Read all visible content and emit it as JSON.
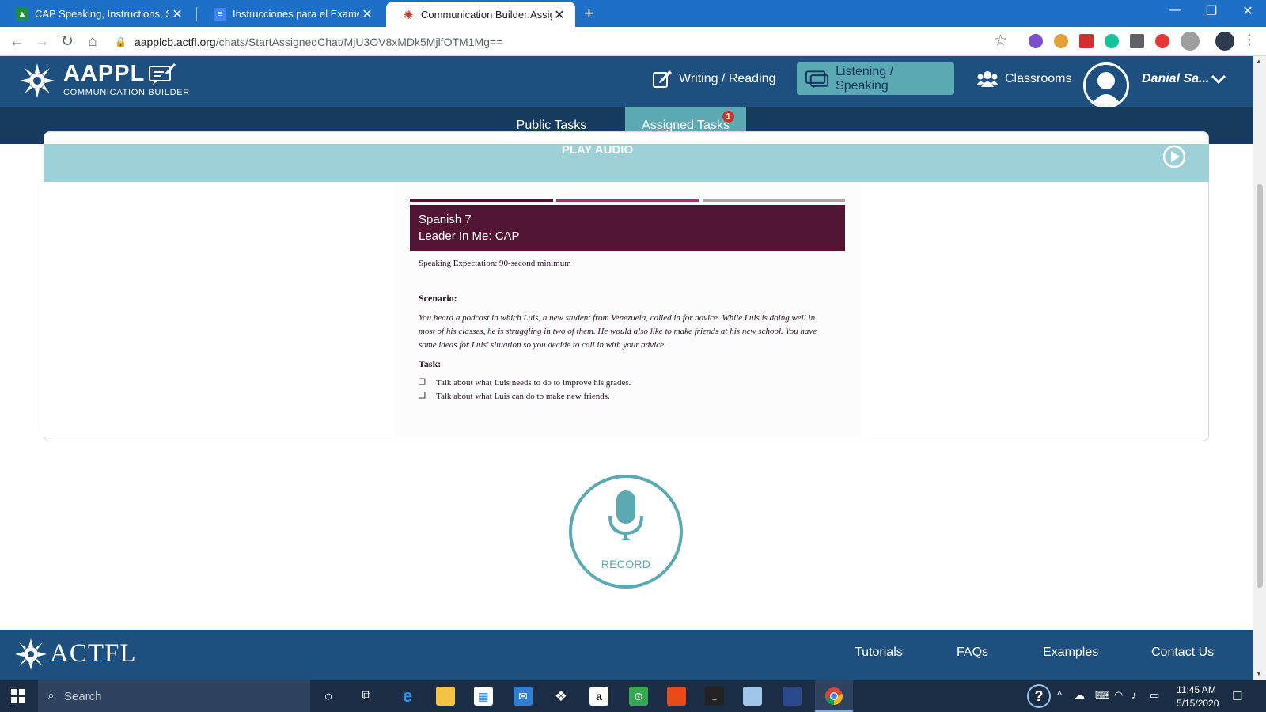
{
  "browser": {
    "tabs": [
      {
        "title": "CAP Speaking, Instructions, Span",
        "icon": "classroom-favicon"
      },
      {
        "title": "Instrucciones para el Examen: CA",
        "icon": "docs-favicon"
      },
      {
        "title": "Communication Builder:Assigned",
        "icon": "aappl-favicon"
      }
    ],
    "close_glyph": "✕",
    "new_tab_glyph": "+",
    "url_host": "aapplcb.actfl.org",
    "url_path": "/chats/StartAssignedChat/MjU3OV8xMDk5MjlfOTM1Mg==",
    "window_controls": [
      "—",
      "❐",
      "✕"
    ]
  },
  "site": {
    "brand_title": "AAPPL",
    "brand_subtitle": "COMMUNICATION BUILDER",
    "nav": [
      {
        "label": "Writing / Reading",
        "icon": "pencil-edit-icon",
        "active": false
      },
      {
        "label": "Listening / Speaking",
        "icon": "chat-bubbles-icon",
        "active": true
      },
      {
        "label": "Classrooms",
        "icon": "people-group-icon",
        "active": false
      }
    ],
    "user_name": "Danial Sa...",
    "subtabs": [
      {
        "label": "Public Tasks",
        "active": false
      },
      {
        "label": "Assigned Tasks",
        "active": true,
        "badge": "1"
      }
    ]
  },
  "audio": {
    "label": "PLAY AUDIO",
    "icon": "play-circle-icon"
  },
  "prompt_doc": {
    "stripe_colors": [
      "#521634",
      "#a3336a",
      "#a6a6a6"
    ],
    "course": "Spanish 7",
    "unit": "Leader In Me: CAP",
    "expectation": "Speaking Expectation: 90-second minimum",
    "scenario_heading": "Scenario:",
    "scenario_body": "You heard a podcast in which Luis, a new student from Venezuela, called in for advice. While Luis is doing well in most of his classes, he is struggling in two of them. He would also like to make friends at his new school. You have some ideas for Luis' situation so you decide to call in with your advice.",
    "task_heading": "Task:",
    "tasks": [
      "Talk about what Luis needs to do to improve his grades.",
      "Talk about what Luis can do to make new friends."
    ],
    "checkbox_glyph": "❑"
  },
  "record": {
    "label": "RECORD",
    "icon": "microphone-icon"
  },
  "footer": {
    "brand": "ACTFL",
    "links": [
      "Tutorials",
      "FAQs",
      "Examples",
      "Contact Us"
    ]
  },
  "taskbar": {
    "search_placeholder": "Search",
    "time": "11:45 AM",
    "date": "5/15/2020",
    "help_glyph": "?"
  },
  "colors": {
    "chrome_blue": "#1d6fc7",
    "header_blue": "#1d4f7f",
    "subnav_blue": "#173b5e",
    "teal_accent": "#5ba9b3",
    "audio_bar": "#9ed0d7",
    "banner_maroon": "#521634",
    "taskbar": "#1b2d45"
  }
}
